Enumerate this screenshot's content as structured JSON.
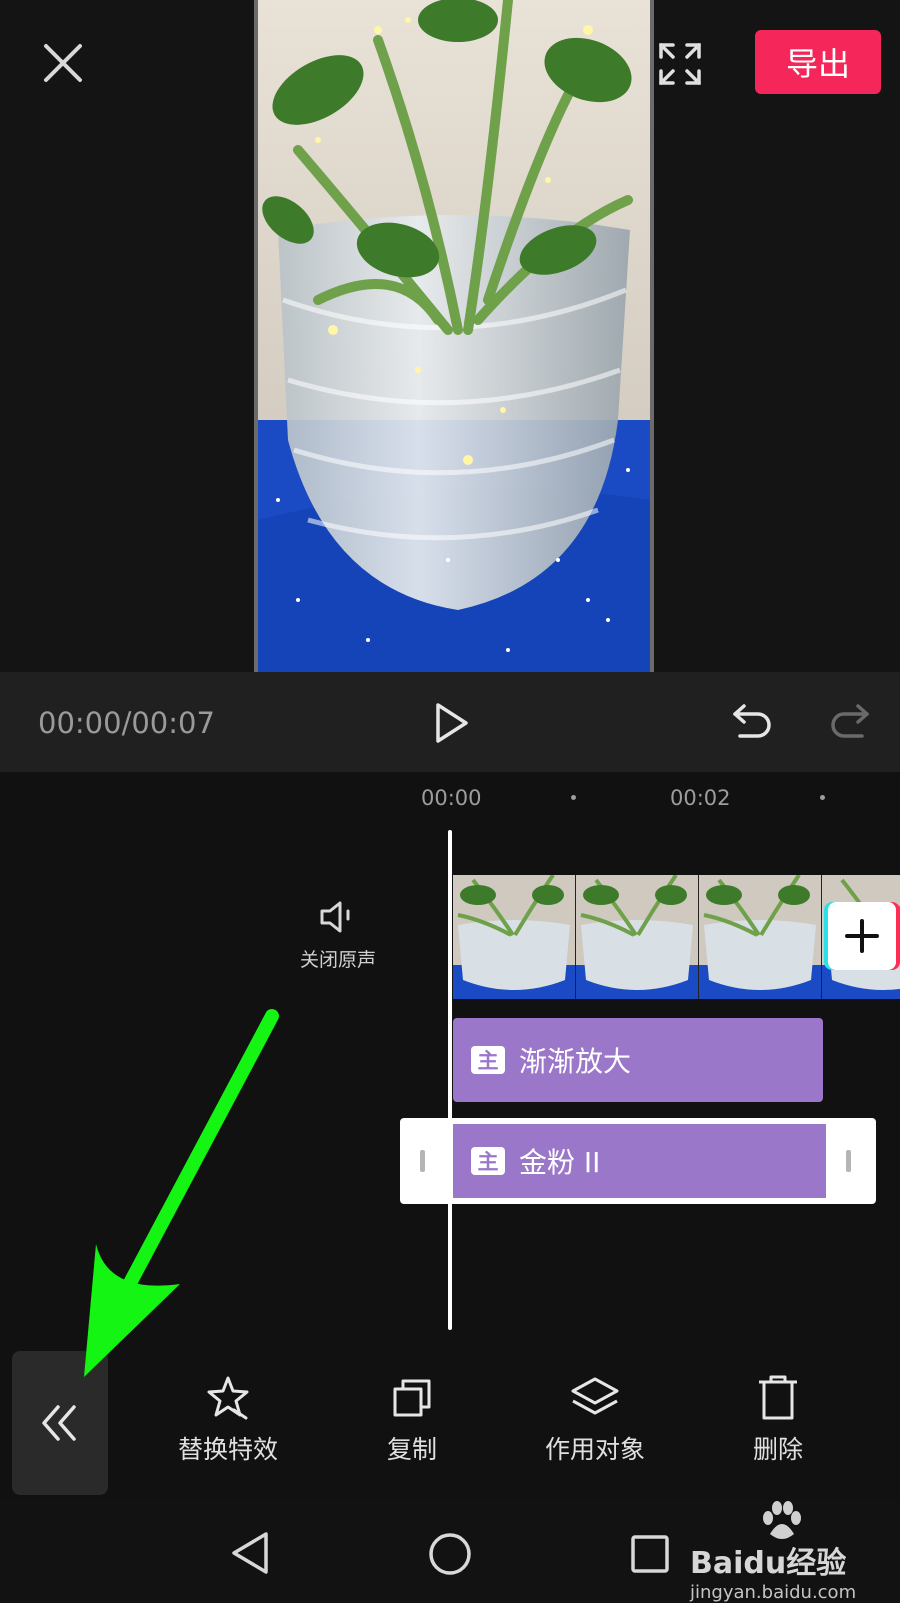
{
  "header": {
    "export_label": "导出"
  },
  "playback": {
    "time": "00:00/00:07"
  },
  "timeline": {
    "ruler": [
      {
        "label": "00:00"
      },
      {
        "label": "00:02"
      }
    ],
    "mute_label": "关闭原声",
    "effects": [
      {
        "badge": "主",
        "name": "渐渐放大"
      },
      {
        "badge": "主",
        "name": "金粉 II"
      }
    ]
  },
  "toolbar": {
    "items": [
      {
        "label": "替换特效",
        "icon": "star-replace-icon"
      },
      {
        "label": "复制",
        "icon": "copy-icon"
      },
      {
        "label": "作用对象",
        "icon": "layers-icon"
      },
      {
        "label": "删除",
        "icon": "trash-icon"
      }
    ]
  },
  "watermark": {
    "brand": "Baidu经验",
    "url": "jingyan.baidu.com"
  },
  "colors": {
    "accent": "#f5275a",
    "effect_clip": "#9b77c9",
    "annotation_arrow": "#14f514"
  }
}
